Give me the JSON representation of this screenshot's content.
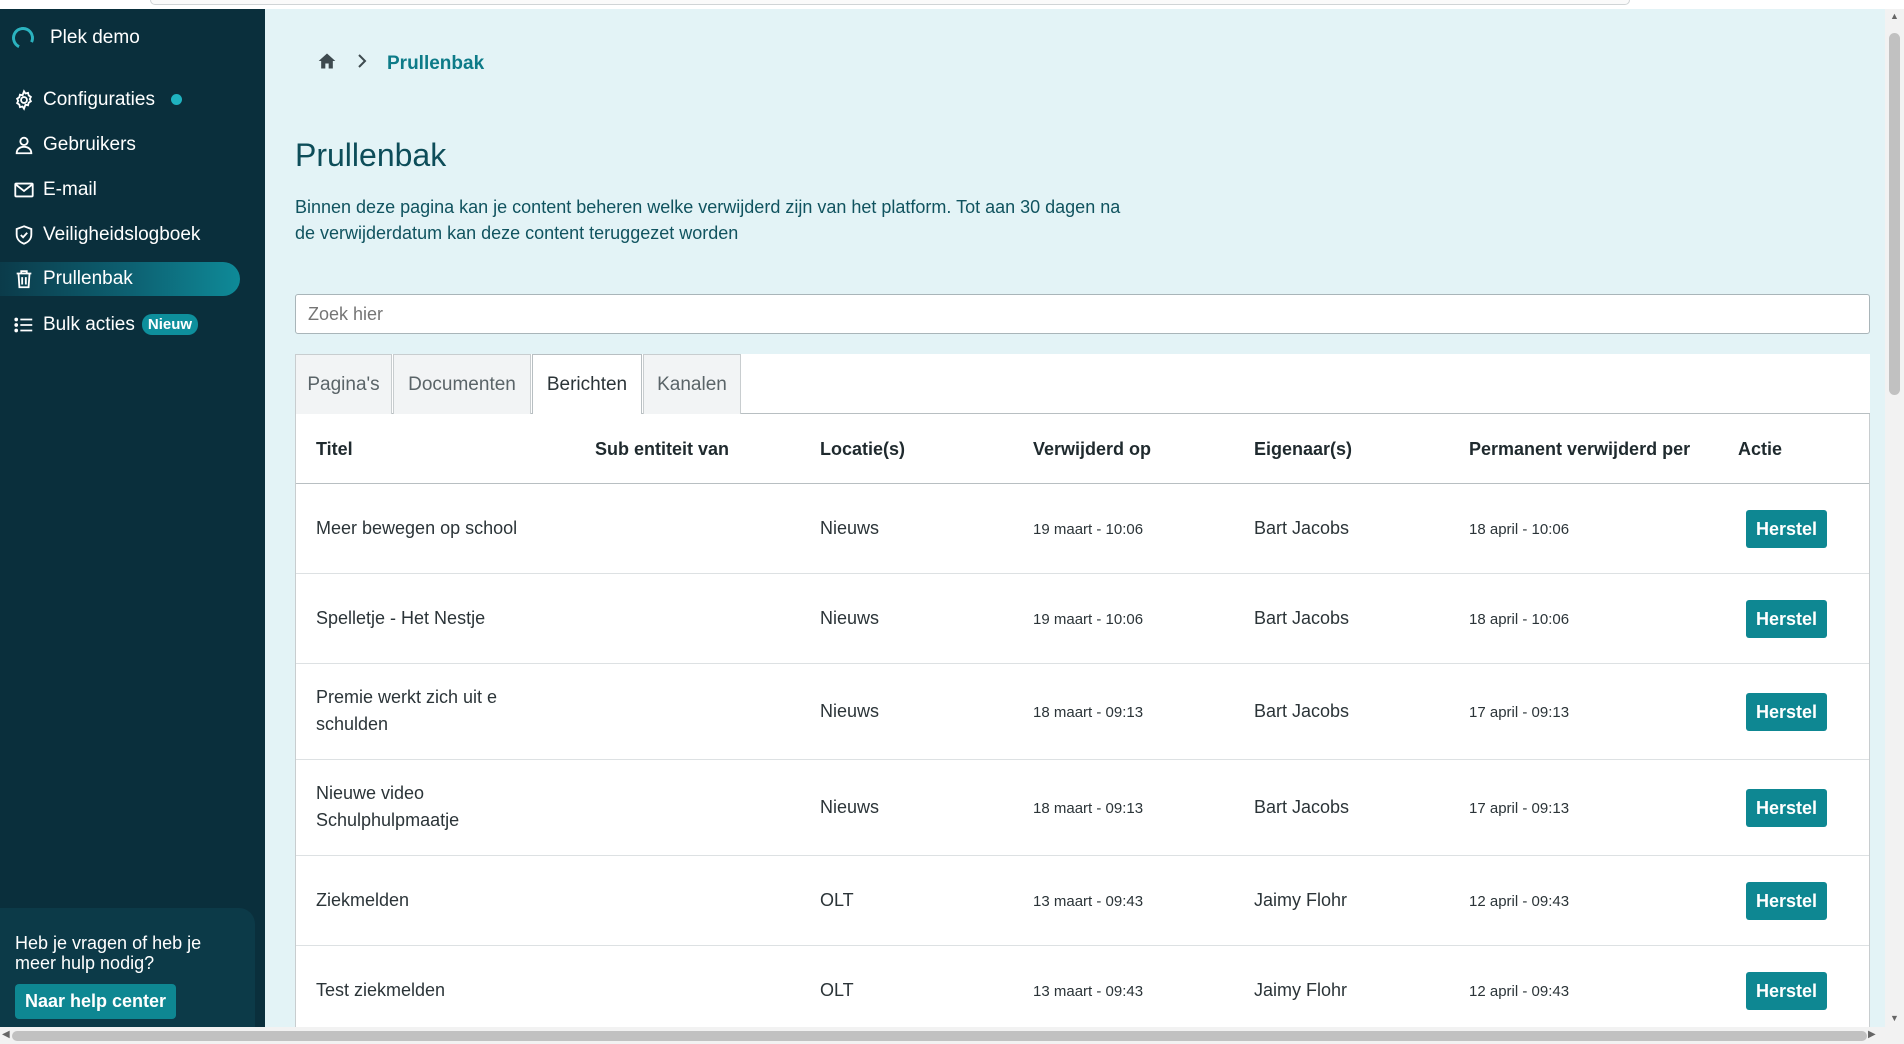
{
  "app": {
    "name": "Plek demo"
  },
  "sidebar": {
    "items": [
      {
        "label": "Configuraties",
        "icon": "gear-icon"
      },
      {
        "label": "Gebruikers",
        "icon": "user-icon"
      },
      {
        "label": "E-mail",
        "icon": "mail-icon"
      },
      {
        "label": "Veiligheidslogboek",
        "icon": "shield-icon"
      },
      {
        "label": "Prullenbak",
        "icon": "trash-icon",
        "active": true
      },
      {
        "label": "Bulk acties",
        "icon": "list-icon",
        "badge": "Nieuw"
      }
    ],
    "help": {
      "text": "Heb je vragen of heb je meer hulp nodig?",
      "button": "Naar help center"
    }
  },
  "breadcrumb": {
    "home_icon": "home-icon",
    "current": "Prullenbak"
  },
  "page": {
    "title": "Prullenbak",
    "description": "Binnen deze pagina kan je content beheren welke verwijderd zijn van het platform. Tot aan 30 dagen na de verwijderdatum kan deze content teruggezet worden"
  },
  "search": {
    "placeholder": "Zoek hier",
    "value": ""
  },
  "tabs": [
    {
      "label": "Pagina's"
    },
    {
      "label": "Documenten"
    },
    {
      "label": "Berichten",
      "active": true
    },
    {
      "label": "Kanalen"
    }
  ],
  "table": {
    "headers": [
      "Titel",
      "Sub entiteit van",
      "Locatie(s)",
      "Verwijderd op",
      "Eigenaar(s)",
      "Permanent verwijderd per",
      "Actie"
    ],
    "action_label": "Herstel",
    "rows": [
      {
        "title": "Meer bewegen op school",
        "sub": "",
        "location": "Nieuws",
        "deleted": "19 maart - 10:06",
        "owner": "Bart Jacobs",
        "permanent": "18 april - 10:06"
      },
      {
        "title": "Spelletje - Het Nestje",
        "sub": "",
        "location": "Nieuws",
        "deleted": "19 maart - 10:06",
        "owner": "Bart Jacobs",
        "permanent": "18 april - 10:06"
      },
      {
        "title": "Premie werkt zich uit e schulden",
        "sub": "",
        "location": "Nieuws",
        "deleted": "18 maart - 09:13",
        "owner": "Bart Jacobs",
        "permanent": "17 april - 09:13"
      },
      {
        "title": "Nieuwe video Schulphulpmaatje",
        "sub": "",
        "location": "Nieuws",
        "deleted": "18 maart - 09:13",
        "owner": "Bart Jacobs",
        "permanent": "17 april - 09:13"
      },
      {
        "title": "Ziekmelden",
        "sub": "",
        "location": "OLT",
        "deleted": "13 maart - 09:43",
        "owner": "Jaimy Flohr",
        "permanent": "12 april - 09:43"
      },
      {
        "title": "Test ziekmelden",
        "sub": "",
        "location": "OLT",
        "deleted": "13 maart - 09:43",
        "owner": "Jaimy Flohr",
        "permanent": "12 april - 09:43"
      }
    ]
  },
  "colors": {
    "sidebar": "#0a2f3c",
    "accent": "#0e8792",
    "content_bg": "#e3f3f6"
  }
}
